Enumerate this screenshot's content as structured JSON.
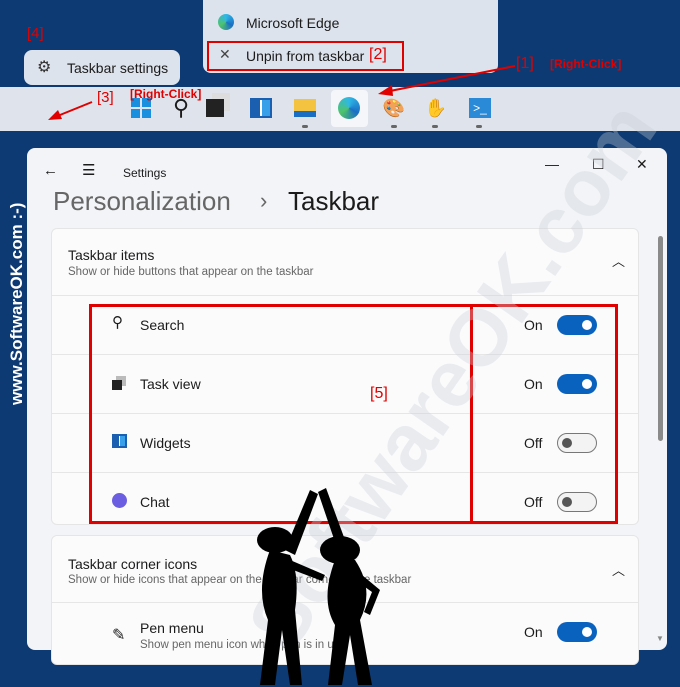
{
  "annotations": {
    "n1": "[1]",
    "rc1": "[Right-Click]",
    "n2": "[2]",
    "n3": "[3]",
    "rc3": "[Right-Click]",
    "n4": "[4]",
    "n5": "[5]"
  },
  "jump_menu": {
    "app": "Microsoft Edge",
    "unpin": "Unpin from taskbar"
  },
  "context_menu": {
    "taskbar_settings": "Taskbar settings"
  },
  "taskbar": {
    "icons": [
      "start-icon",
      "search-icon",
      "task-view-icon",
      "widgets-icon",
      "file-explorer-icon",
      "edge-icon",
      "paint-icon",
      "hand-icon",
      "powershell-icon"
    ]
  },
  "window": {
    "title": "Settings",
    "breadcrumb_parent": "Personalization",
    "breadcrumb_sep": "›",
    "page_title": "Taskbar"
  },
  "sections": [
    {
      "title": "Taskbar items",
      "subtitle": "Show or hide buttons that appear on the taskbar",
      "items": [
        {
          "label": "Search",
          "state": "On"
        },
        {
          "label": "Task view",
          "state": "On"
        },
        {
          "label": "Widgets",
          "state": "Off"
        },
        {
          "label": "Chat",
          "state": "Off"
        }
      ]
    },
    {
      "title": "Taskbar corner icons",
      "subtitle": "Show or hide icons that appear on the taskbar corner of the taskbar",
      "items": [
        {
          "label": "Pen menu",
          "desc": "Show pen menu icon when pen is in use",
          "state": "On"
        }
      ]
    }
  ],
  "watermark": {
    "side": "www.SoftwareOK.com :-)",
    "diag": "SoftwareOK.com"
  },
  "colors": {
    "accent": "#0a62bf",
    "annotation": "#e00000",
    "background": "#0d3a72"
  }
}
